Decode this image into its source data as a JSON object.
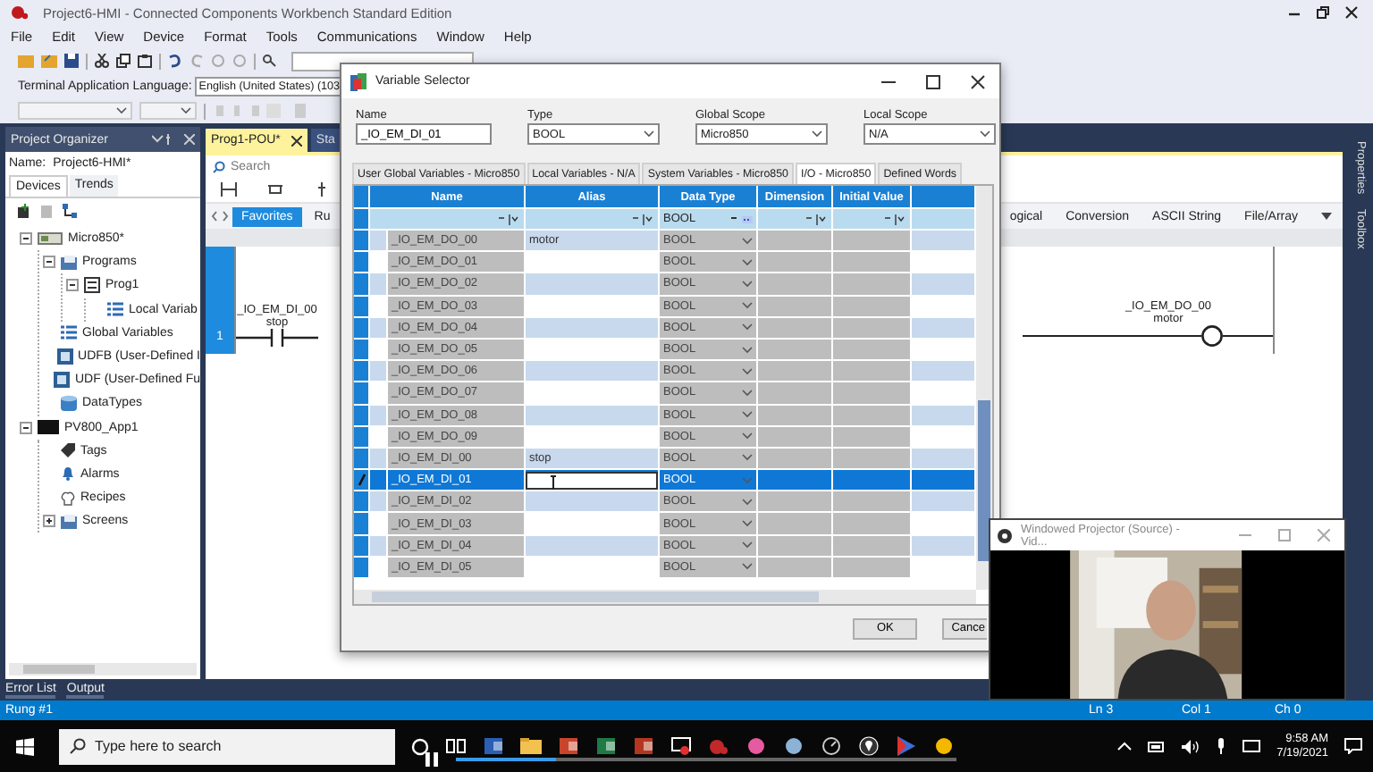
{
  "app": {
    "title": "Project6-HMI - Connected Components Workbench Standard Edition",
    "menu": [
      "File",
      "Edit",
      "View",
      "Device",
      "Format",
      "Tools",
      "Communications",
      "Window",
      "Help"
    ],
    "language_label": "Terminal Application Language:",
    "language_value": "English (United States) (103"
  },
  "organizer": {
    "title": "Project Organizer",
    "name_label": "Name:",
    "name_value": "Project6-HMI*",
    "tabs": [
      {
        "label": "Devices",
        "selected": true
      },
      {
        "label": "Trends",
        "selected": false
      }
    ],
    "tree": [
      {
        "label": "Micro850*",
        "kind": "controller",
        "expanded": true,
        "children": [
          {
            "label": "Programs",
            "kind": "folder",
            "expanded": true,
            "children": [
              {
                "label": "Prog1",
                "kind": "program",
                "expanded": true,
                "children": [
                  {
                    "label": "Local Variab",
                    "kind": "list"
                  }
                ]
              }
            ]
          },
          {
            "label": "Global Variables",
            "kind": "list"
          },
          {
            "label": "UDFB (User-Defined I",
            "kind": "block"
          },
          {
            "label": "UDF (User-Defined Fu",
            "kind": "block"
          },
          {
            "label": "DataTypes",
            "kind": "database"
          }
        ]
      },
      {
        "label": "PV800_App1",
        "kind": "screen",
        "expanded": true,
        "children": [
          {
            "label": "Tags",
            "kind": "tag"
          },
          {
            "label": "Alarms",
            "kind": "bell"
          },
          {
            "label": "Recipes",
            "kind": "recipe"
          },
          {
            "label": "Screens",
            "kind": "folder",
            "expanded": false
          }
        ]
      }
    ]
  },
  "editor": {
    "tabs": [
      {
        "label": "Prog1-POU*",
        "selected": true
      },
      {
        "label": "Sta",
        "selected": false
      }
    ],
    "search_placeholder": "Search",
    "palette_tabs": [
      {
        "label": "Favorites",
        "selected": true
      },
      {
        "label": "Ru",
        "selected": false
      }
    ],
    "function_tabs": [
      "ogical",
      "Conversion",
      "ASCII String",
      "File/Array"
    ],
    "rung": {
      "number": "1",
      "contact": {
        "name": "_IO_EM_DI_00",
        "alias": "stop"
      },
      "coil": {
        "name": "_IO_EM_DO_00",
        "alias": "motor"
      }
    }
  },
  "side_tabs": [
    "Properties",
    "Toolbox"
  ],
  "bottom_tabs": [
    "Error List",
    "Output"
  ],
  "status": {
    "left": "Rung #1",
    "ln": "Ln 3",
    "col": "Col 1",
    "ch": "Ch 0"
  },
  "dialog": {
    "title": "Variable Selector",
    "fields": [
      {
        "label": "Name",
        "value": "_IO_EM_DI_01",
        "kind": "text"
      },
      {
        "label": "Type",
        "value": "BOOL",
        "kind": "dropdown"
      },
      {
        "label": "Global Scope",
        "value": "Micro850",
        "kind": "dropdown"
      },
      {
        "label": "Local Scope",
        "value": "N/A",
        "kind": "dropdown"
      }
    ],
    "tabs": [
      {
        "label": "User Global Variables - Micro850",
        "selected": false
      },
      {
        "label": "Local Variables - N/A",
        "selected": false
      },
      {
        "label": "System Variables - Micro850",
        "selected": false
      },
      {
        "label": "I/O - Micro850",
        "selected": true
      },
      {
        "label": "Defined Words",
        "selected": false
      }
    ],
    "columns": [
      "Name",
      "Alias",
      "Data Type",
      "Dimension",
      "Initial Value"
    ],
    "filter_type": "BOOL",
    "rows": [
      {
        "name": "_IO_EM_DO_00",
        "alias": "motor",
        "data_type": "BOOL",
        "selected": false
      },
      {
        "name": "_IO_EM_DO_01",
        "data_type": "BOOL",
        "selected": false
      },
      {
        "name": "_IO_EM_DO_02",
        "data_type": "BOOL",
        "selected": false
      },
      {
        "name": "_IO_EM_DO_03",
        "data_type": "BOOL",
        "selected": false
      },
      {
        "name": "_IO_EM_DO_04",
        "data_type": "BOOL",
        "selected": false
      },
      {
        "name": "_IO_EM_DO_05",
        "data_type": "BOOL",
        "selected": false
      },
      {
        "name": "_IO_EM_DO_06",
        "data_type": "BOOL",
        "selected": false
      },
      {
        "name": "_IO_EM_DO_07",
        "data_type": "BOOL",
        "selected": false
      },
      {
        "name": "_IO_EM_DO_08",
        "data_type": "BOOL",
        "selected": false
      },
      {
        "name": "_IO_EM_DO_09",
        "data_type": "BOOL",
        "selected": false
      },
      {
        "name": "_IO_EM_DI_00",
        "alias": "stop",
        "data_type": "BOOL",
        "selected": false
      },
      {
        "name": "_IO_EM_DI_01",
        "data_type": "BOOL",
        "selected": true
      },
      {
        "name": "_IO_EM_DI_02",
        "data_type": "BOOL",
        "selected": false
      },
      {
        "name": "_IO_EM_DI_03",
        "data_type": "BOOL",
        "selected": false
      },
      {
        "name": "_IO_EM_DI_04",
        "data_type": "BOOL",
        "selected": false
      },
      {
        "name": "_IO_EM_DI_05",
        "data_type": "BOOL",
        "selected": false
      }
    ],
    "buttons": [
      "OK",
      "Cance"
    ]
  },
  "projector": {
    "title": "Windowed Projector (Source) - Vid..."
  },
  "taskbar": {
    "search_placeholder": "Type here to search",
    "time": "9:58 AM",
    "date": "7/19/2021",
    "video_overlay": {
      "level": 0.2
    }
  }
}
